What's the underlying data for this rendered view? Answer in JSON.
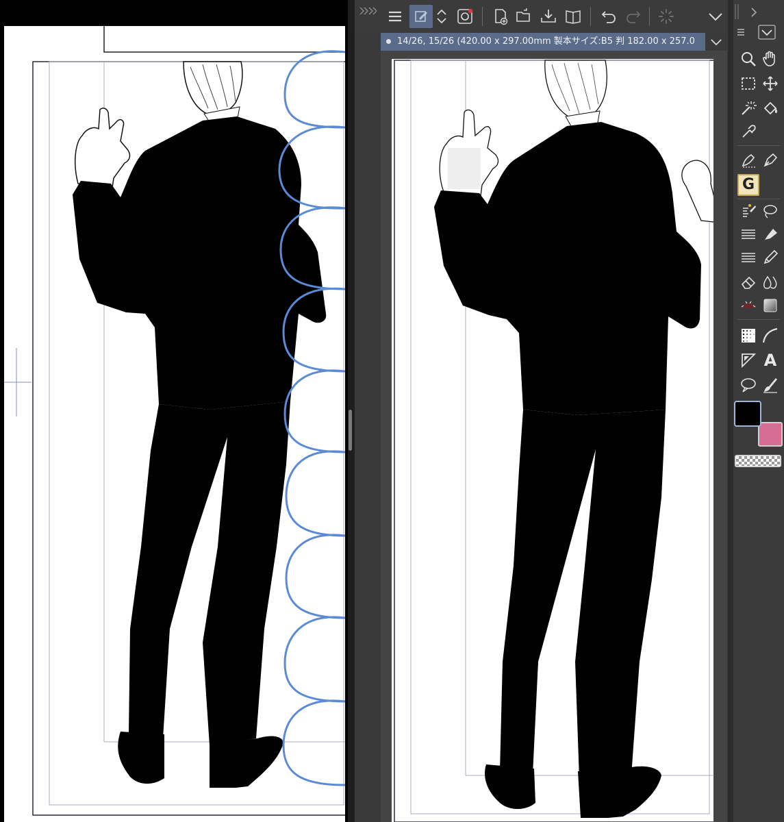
{
  "document_tab": {
    "title": "14/26, 15/26 (420.00 x 297.00mm 製本サイズ:B5 判 182.00 x 257.0"
  },
  "toolbar": {
    "icons": [
      "collapse-arrows-icon",
      "menu-icon",
      "pen-settings-icon",
      "chevron-updown-icon",
      "layer-record-icon",
      "new-file-icon",
      "open-folder-icon",
      "save-icon",
      "book-icon",
      "undo-icon",
      "redo-icon",
      "loading-spinner-icon",
      "chevron-down-icon"
    ]
  },
  "tool_palette": {
    "active_tool_letter": "G",
    "text_tool_letter": "A",
    "tools": [
      "zoom",
      "hand",
      "select-rect",
      "move",
      "magic-wand",
      "fill",
      "eyedropper",
      "pen",
      "g-pen",
      "balloon",
      "lasso",
      "lines",
      "marker",
      "lines2",
      "pencil",
      "eraser",
      "drops",
      "airbrush",
      "gradient",
      "tone",
      "curve",
      "ruler",
      "text",
      "speech",
      "brush"
    ]
  },
  "colors": {
    "main": "#000000",
    "sub": "#d76c94",
    "tab_background": "#5b6c8a",
    "toolbar_background": "#3b3b3b",
    "balloon_stroke": "#5b8bd6"
  }
}
